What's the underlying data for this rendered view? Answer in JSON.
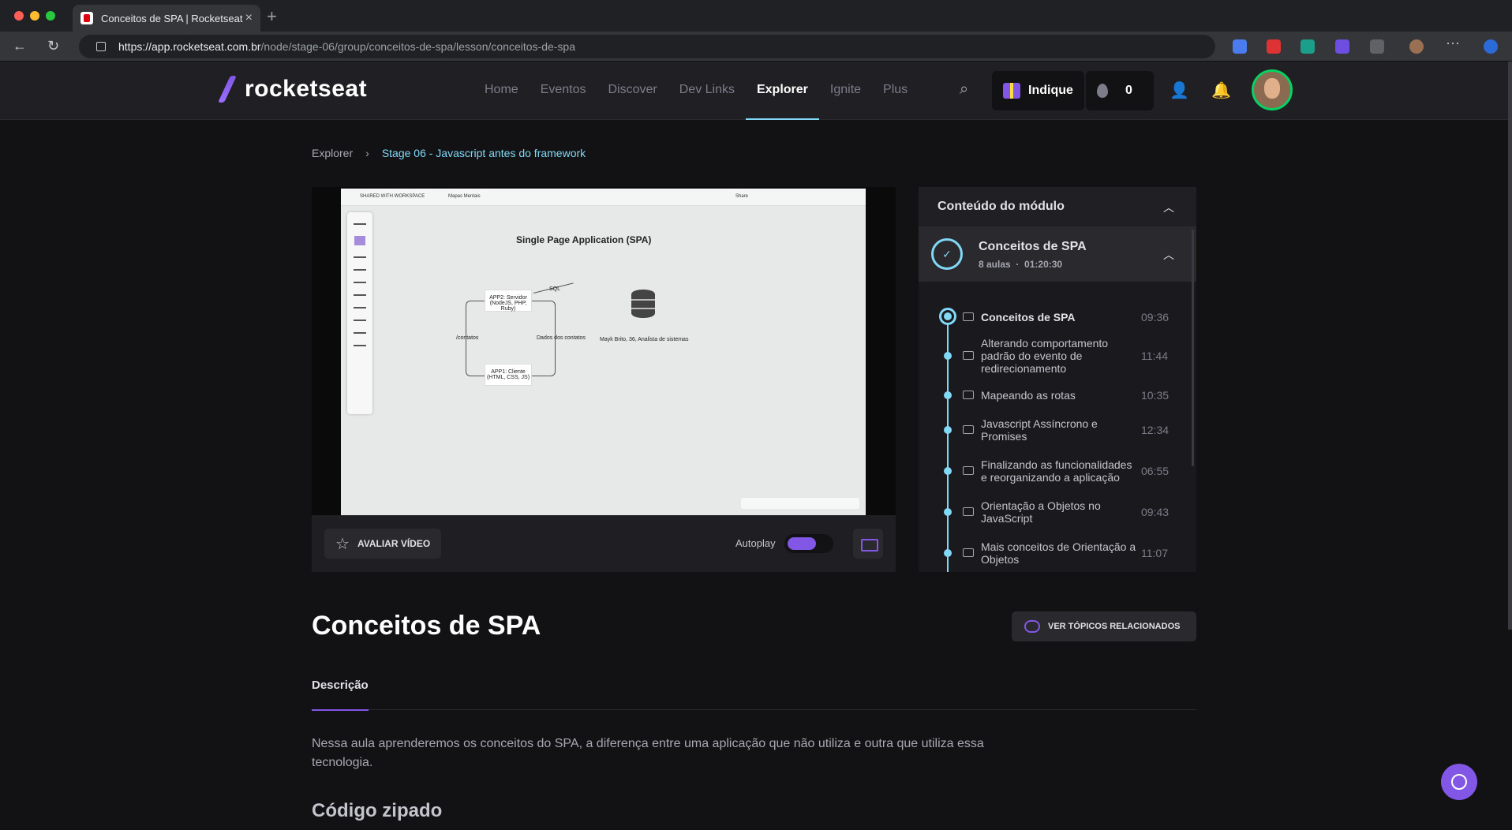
{
  "browser": {
    "tab_title": "Conceitos de SPA | Rocketseat",
    "url_host": "https://app.rocketseat.com.br",
    "url_path": "/node/stage-06/group/conceitos-de-spa/lesson/conceitos-de-spa"
  },
  "header": {
    "logo": "rocketseat",
    "nav": [
      "Home",
      "Eventos",
      "Discover",
      "Dev Links",
      "Explorer",
      "Ignite",
      "Plus"
    ],
    "active_nav": "Explorer",
    "indique": "Indique",
    "points": "0"
  },
  "breadcrumb": {
    "root": "Explorer",
    "current": "Stage 06 - Javascript antes do framework"
  },
  "video": {
    "whiteboard_title": "Single Page Application (SPA)",
    "workspace_label": "SHARED WITH WORKSPACE",
    "board_name": "Mapas Mentais",
    "share_label": "Share",
    "server_box": "APP2: Servidor (NodeJS, PHP, Ruby)",
    "client_box": "APP1: Cliente (HTML, CSS, JS)",
    "label_sql": "SQL",
    "label_contatos": "/contatos",
    "label_dados": "Dados dos contatos",
    "label_author": "Mayk Brito, 36, Analista de sistemas",
    "rate_label": "AVALIAR VÍDEO",
    "autoplay_label": "Autoplay"
  },
  "sidebar": {
    "title": "Conteúdo do módulo",
    "module": {
      "name": "Conceitos de SPA",
      "lessons_count": "8 aulas",
      "total_time": "01:20:30"
    },
    "lessons": [
      {
        "title": "Conceitos de SPA",
        "duration": "09:36",
        "current": true
      },
      {
        "title": "Alterando comportamento padrão do evento de redirecionamento",
        "duration": "11:44"
      },
      {
        "title": "Mapeando as rotas",
        "duration": "10:35"
      },
      {
        "title": "Javascript Assíncrono e Promises",
        "duration": "12:34"
      },
      {
        "title": "Finalizando as funcionalidades e reorganizando a aplicação",
        "duration": "06:55"
      },
      {
        "title": "Orientação a Objetos no JavaScript",
        "duration": "09:43"
      },
      {
        "title": "Mais conceitos de Orientação a Objetos",
        "duration": "11:07"
      }
    ]
  },
  "lesson": {
    "title": "Conceitos de SPA",
    "related_button": "VER TÓPICOS RELACIONADOS",
    "tab": "Descrição",
    "description": "Nessa aula aprenderemos os conceitos do SPA, a diferença entre uma aplicação que não utiliza e outra que utiliza essa tecnologia.",
    "section_heading": "Código zipado"
  },
  "colors": {
    "accent": "#8257e5",
    "cyan": "#81d8f7",
    "bg": "#121214"
  }
}
